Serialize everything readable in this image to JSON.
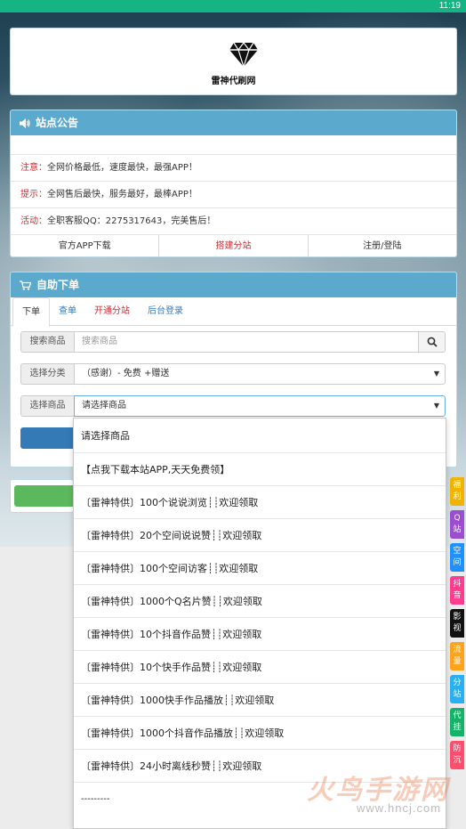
{
  "status_bar": {
    "time": "11:19"
  },
  "logo": {
    "text": "雷神代刷网"
  },
  "announcement": {
    "title": "站点公告",
    "lines": [
      {
        "tag": "注意：",
        "text": "全网价格最低，速度最快，最强APP！"
      },
      {
        "tag": "提示：",
        "text": "全网售后最快，服务最好，最棒APP！"
      },
      {
        "tag": "活动：",
        "text": "全职客服QQ：2275317643，完美售后！"
      }
    ],
    "links": [
      "官方APP下载",
      "搭建分站",
      "注册/登陆"
    ]
  },
  "order": {
    "title": "自助下单",
    "tabs": [
      "下单",
      "查单",
      "开通分站",
      "后台登录"
    ],
    "search_label": "搜索商品",
    "search_placeholder": "搜索商品",
    "category_label": "选择分类",
    "category_value": "（感谢）- 免费 +赠送",
    "product_label": "选择商品",
    "product_value": "请选择商品"
  },
  "dropdown": {
    "options": [
      "请选择商品",
      "【点我下载本站APP,天天免费领】",
      "〔雷神特供〕100个说说浏览┊┊欢迎领取",
      "〔雷神特供〕20个空间说说赞┊┊欢迎领取",
      "〔雷神特供〕100个空间访客┊┊欢迎领取",
      "〔雷神特供〕1000个Q名片赞┊┊欢迎领取",
      "〔雷神特供〕10个抖音作品赞┊┊欢迎领取",
      "〔雷神特供〕10个快手作品赞┊┊欢迎领取",
      "〔雷神特供〕1000快手作品播放┊┊欢迎领取",
      "〔雷神特供〕1000个抖音作品播放┊┊欢迎领取",
      "〔雷神特供〕24小时离线秒赞┊┊欢迎领取",
      "---------"
    ]
  },
  "float_tabs": [
    {
      "label": [
        "福",
        "利"
      ],
      "color": "#f0b400"
    },
    {
      "label": [
        "Q",
        "站"
      ],
      "color": "#9b4fd0"
    },
    {
      "label": [
        "空",
        "间"
      ],
      "color": "#1e90ff"
    },
    {
      "label": [
        "抖",
        "音"
      ],
      "color": "#ff3c8e"
    },
    {
      "label": [
        "影",
        "视"
      ],
      "color": "#111111"
    },
    {
      "label": [
        "流",
        "量"
      ],
      "color": "#ffa31a"
    },
    {
      "label": [
        "分",
        "站"
      ],
      "color": "#2ab0f0"
    },
    {
      "label": [
        "代",
        "挂"
      ],
      "color": "#17b26a"
    },
    {
      "label": [
        "防",
        "沉"
      ],
      "color": "#ff4d6d"
    }
  ],
  "watermark": {
    "big": "火鸟手游网",
    "small": "www.hncj.com"
  }
}
